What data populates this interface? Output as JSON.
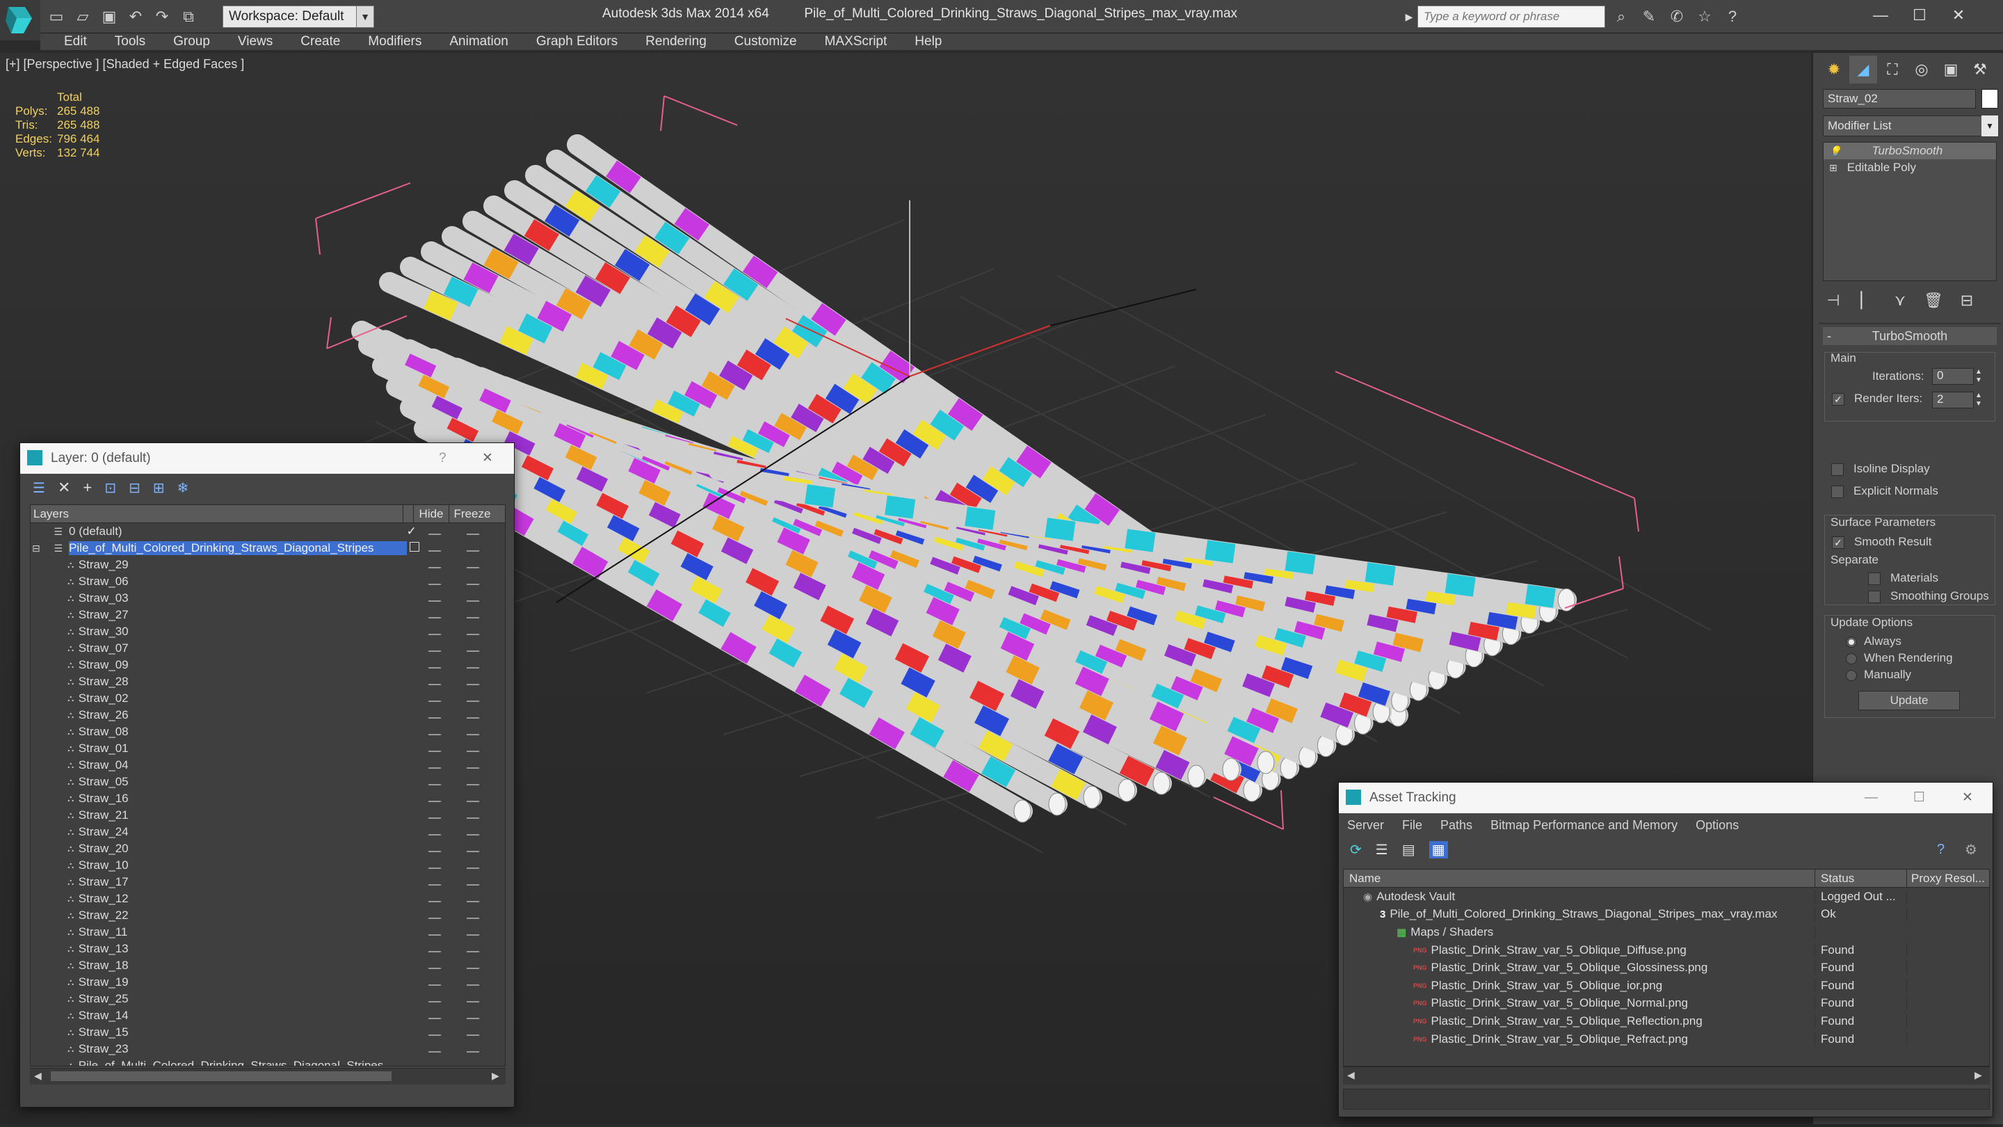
{
  "titlebar": {
    "app_title": "Autodesk 3ds Max 2014 x64",
    "file_name": "Pile_of_Multi_Colored_Drinking_Straws_Diagonal_Stripes_max_vray.max",
    "workspace": "Workspace: Default",
    "search_placeholder": "Type a keyword or phrase"
  },
  "menu": [
    "Edit",
    "Tools",
    "Group",
    "Views",
    "Create",
    "Modifiers",
    "Animation",
    "Graph Editors",
    "Rendering",
    "Customize",
    "MAXScript",
    "Help"
  ],
  "viewport": {
    "label": "[+] [Perspective ] [Shaded + Edged Faces ]",
    "stats": {
      "header": "Total",
      "rows": [
        {
          "label": "Polys:",
          "value": "265 488"
        },
        {
          "label": "Tris:",
          "value": "265 488"
        },
        {
          "label": "Edges:",
          "value": "796 464"
        },
        {
          "label": "Verts:",
          "value": "132 744"
        }
      ]
    },
    "straw_colors": [
      "#e83030",
      "#2a48d8",
      "#f0e030",
      "#25c8d8",
      "#c838e0",
      "#f0a020",
      "#9a30d0"
    ]
  },
  "command_panel": {
    "object_name": "Straw_02",
    "modifier_list": "Modifier List",
    "stack": [
      "TurboSmooth",
      "Editable Poly"
    ],
    "rollout_title": "TurboSmooth",
    "main_label": "Main",
    "iterations_label": "Iterations:",
    "iterations_value": "0",
    "render_iters_label": "Render Iters:",
    "render_iters_value": "2",
    "isoline": "Isoline Display",
    "explicit_normals": "Explicit Normals",
    "surface_params": "Surface Parameters",
    "smooth_result": "Smooth Result",
    "separate": "Separate",
    "materials": "Materials",
    "smoothing_groups": "Smoothing Groups",
    "update_options": "Update Options",
    "always": "Always",
    "when_rendering": "When Rendering",
    "manually": "Manually",
    "update_button": "Update"
  },
  "layer_dialog": {
    "title": "Layer: 0 (default)",
    "col_layers": "Layers",
    "col_hide": "Hide",
    "col_freeze": "Freeze",
    "default_layer": "0 (default)",
    "main_layer": "Pile_of_Multi_Colored_Drinking_Straws_Diagonal_Stripes",
    "objects": [
      "Straw_29",
      "Straw_06",
      "Straw_03",
      "Straw_27",
      "Straw_30",
      "Straw_07",
      "Straw_09",
      "Straw_28",
      "Straw_02",
      "Straw_26",
      "Straw_08",
      "Straw_01",
      "Straw_04",
      "Straw_05",
      "Straw_16",
      "Straw_21",
      "Straw_24",
      "Straw_20",
      "Straw_10",
      "Straw_17",
      "Straw_12",
      "Straw_22",
      "Straw_11",
      "Straw_13",
      "Straw_18",
      "Straw_19",
      "Straw_25",
      "Straw_14",
      "Straw_15",
      "Straw_23",
      "Pile_of_Multi_Colored_Drinking_Straws_Diagonal_Stripes"
    ]
  },
  "asset_dialog": {
    "title": "Asset Tracking",
    "menu": [
      "Server",
      "File",
      "Paths",
      "Bitmap Performance and Memory",
      "Options"
    ],
    "col_name": "Name",
    "col_status": "Status",
    "col_proxy": "Proxy Resol...",
    "rows": [
      {
        "name": "Autodesk Vault",
        "status": "Logged Out ...",
        "indent": 0
      },
      {
        "name": "Pile_of_Multi_Colored_Drinking_Straws_Diagonal_Stripes_max_vray.max",
        "status": "Ok",
        "indent": 1
      },
      {
        "name": "Maps / Shaders",
        "status": "",
        "indent": 2
      },
      {
        "name": "Plastic_Drink_Straw_var_5_Oblique_Diffuse.png",
        "status": "Found",
        "indent": 3
      },
      {
        "name": "Plastic_Drink_Straw_var_5_Oblique_Glossiness.png",
        "status": "Found",
        "indent": 3
      },
      {
        "name": "Plastic_Drink_Straw_var_5_Oblique_ior.png",
        "status": "Found",
        "indent": 3
      },
      {
        "name": "Plastic_Drink_Straw_var_5_Oblique_Normal.png",
        "status": "Found",
        "indent": 3
      },
      {
        "name": "Plastic_Drink_Straw_var_5_Oblique_Reflection.png",
        "status": "Found",
        "indent": 3
      },
      {
        "name": "Plastic_Drink_Straw_var_5_Oblique_Refract.png",
        "status": "Found",
        "indent": 3
      }
    ]
  }
}
